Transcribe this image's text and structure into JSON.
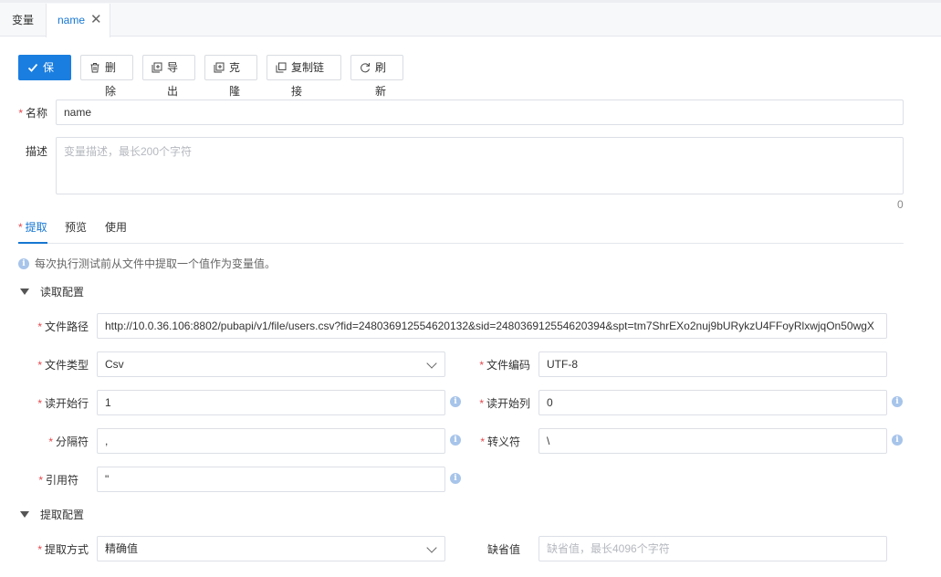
{
  "tabs": [
    {
      "label": "变量"
    },
    {
      "label": "name",
      "close": "✕"
    }
  ],
  "toolbar": {
    "save": "保存",
    "delete": "删除",
    "export": "导出",
    "clone": "克隆",
    "copy_link": "复制链接",
    "refresh": "刷新"
  },
  "form": {
    "name_label": "名称",
    "name_value": "name",
    "desc_label": "描述",
    "desc_placeholder": "变量描述，最长200个字符",
    "desc_count": "0"
  },
  "subtabs": [
    "提取",
    "预览",
    "使用"
  ],
  "hint": "每次执行测试前从文件中提取一个值作为变量值。",
  "read_config": {
    "title": "读取配置",
    "file_path_label": "文件路径",
    "file_path_value": "http://10.0.36.106:8802/pubapi/v1/file/users.csv?fid=248036912554620132&sid=248036912554620394&spt=tm7ShrEXo2nuj9bURykzU4FFoyRlxwjqOn50wgX",
    "file_type_label": "文件类型",
    "file_type_value": "Csv",
    "file_encoding_label": "文件编码",
    "file_encoding_value": "UTF-8",
    "start_row_label": "读开始行",
    "start_row_value": "1",
    "start_col_label": "读开始列",
    "start_col_value": "0",
    "separator_label": "分隔符",
    "separator_value": ",",
    "escape_label": "转义符",
    "escape_value": "\\",
    "quote_label": "引用符",
    "quote_value": "\""
  },
  "extract_config": {
    "title": "提取配置",
    "method_label": "提取方式",
    "method_value": "精确值",
    "default_label": "缺省值",
    "default_placeholder": "缺省值，最长4096个字符"
  },
  "icons": {
    "info": "i"
  },
  "colors": {
    "primary": "#1a7ee0",
    "required": "#e5484d"
  }
}
